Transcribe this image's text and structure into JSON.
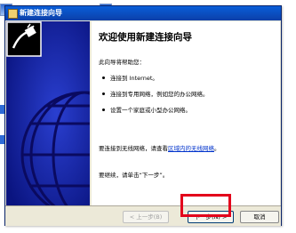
{
  "desktop": {
    "icon_label_left": "",
    "icon_label_right": ""
  },
  "window": {
    "title": "新建连接向导",
    "title_icon": "wizard-icon"
  },
  "side_panel": {
    "icon": "network-cable-icon",
    "background_color": "#0a1a9a"
  },
  "content": {
    "heading": "欢迎使用新建连接向导",
    "intro": "此向导将帮助您：",
    "bullets": [
      "连接到 Internet。",
      "连接到专用网络，例如您的办公网络。",
      "设置一个家庭或小型办公网络。"
    ],
    "wireless_prefix": "要连接到无线网络，请查看",
    "wireless_link": "区域内的无线网络",
    "wireless_suffix": "。",
    "continue": "要继续，请单击“下一步”。"
  },
  "buttons": {
    "back": "< 上一步(B)",
    "next": "下一步(N) >",
    "cancel": "取消"
  },
  "annotation": {
    "highlight_color": "#e3001b"
  }
}
